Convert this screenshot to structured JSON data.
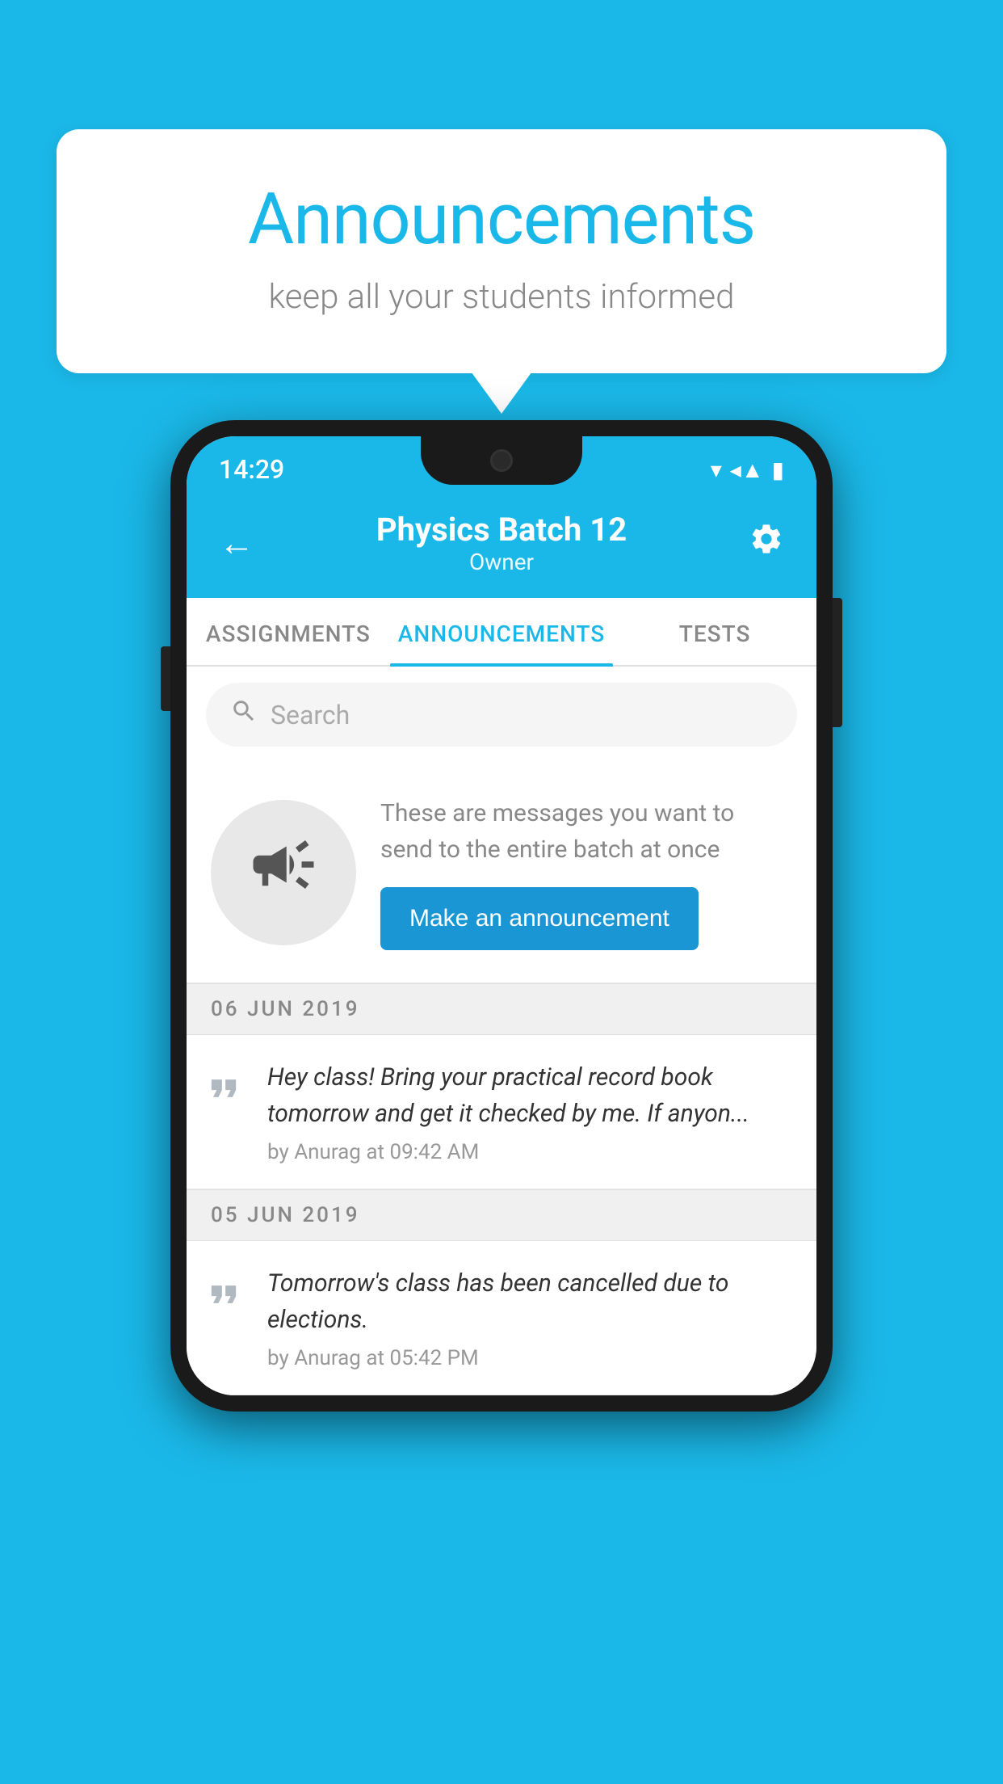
{
  "page": {
    "background_color": "#1ab8e8"
  },
  "speech_bubble": {
    "title": "Announcements",
    "subtitle": "keep all your students informed"
  },
  "phone": {
    "status_bar": {
      "time": "14:29",
      "wifi": "▾",
      "signal": "▲",
      "battery": "▮"
    },
    "header": {
      "title": "Physics Batch 12",
      "subtitle": "Owner",
      "back_label": "←",
      "gear_label": "⚙"
    },
    "tabs": [
      {
        "label": "ASSIGNMENTS",
        "active": false
      },
      {
        "label": "ANNOUNCEMENTS",
        "active": true
      },
      {
        "label": "TESTS",
        "active": false
      }
    ],
    "search": {
      "placeholder": "Search"
    },
    "cta_section": {
      "description": "These are messages you want to send to the entire batch at once",
      "button_label": "Make an announcement"
    },
    "announcements": [
      {
        "date": "06  JUN  2019",
        "text": "Hey class! Bring your practical record book tomorrow and get it checked by me. If anyon...",
        "meta": "by Anurag at 09:42 AM"
      },
      {
        "date": "05  JUN  2019",
        "text": "Tomorrow's class has been cancelled due to elections.",
        "meta": "by Anurag at 05:42 PM"
      }
    ]
  }
}
